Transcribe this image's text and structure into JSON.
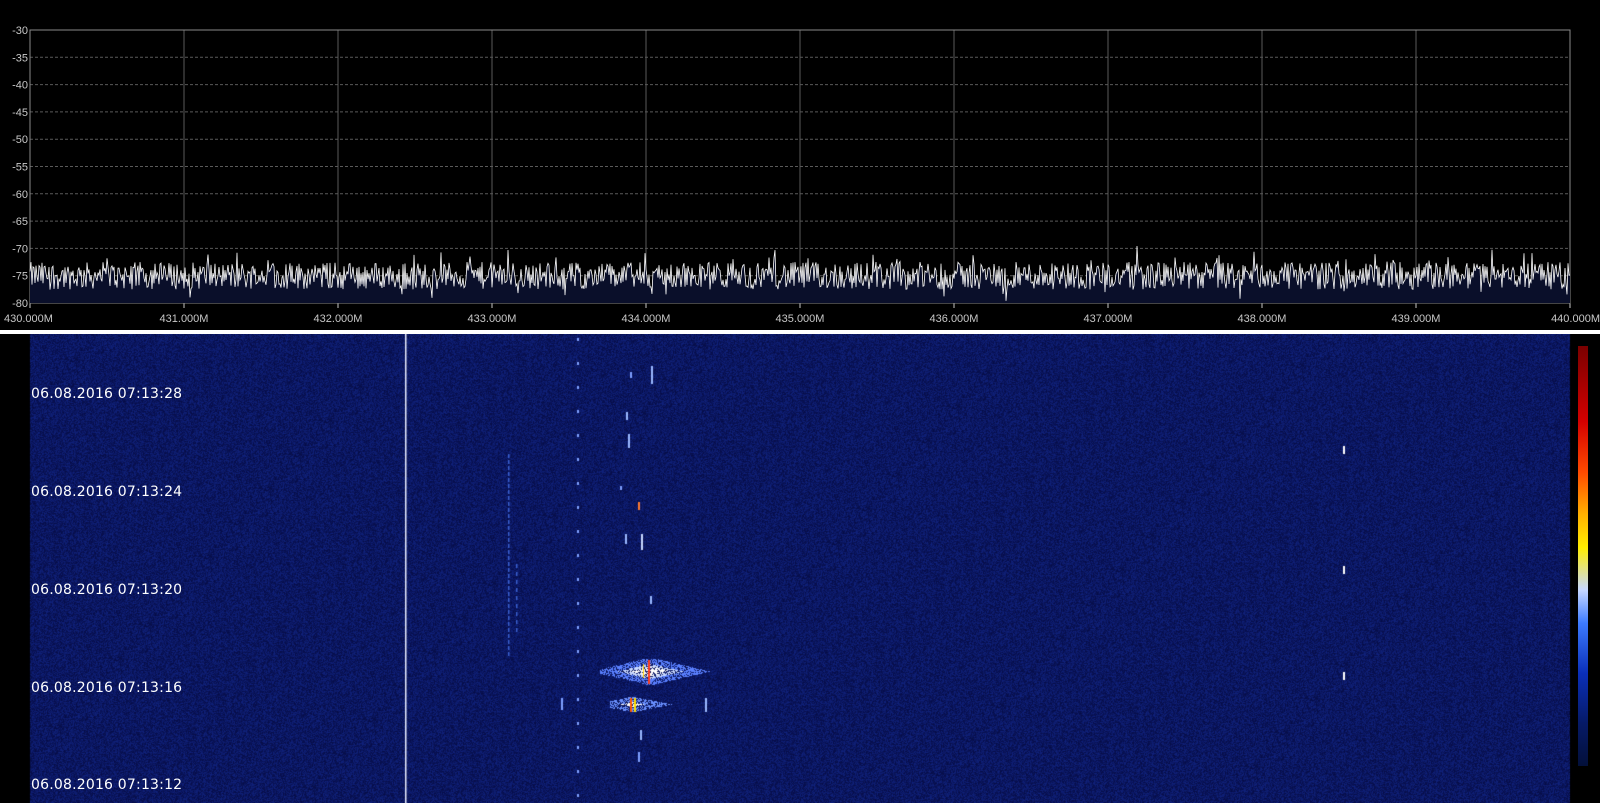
{
  "spectrum": {
    "y_ticks": [
      "-30",
      "-35",
      "-40",
      "-45",
      "-50",
      "-55",
      "-60",
      "-65",
      "-70",
      "-75",
      "-80"
    ],
    "x_ticks": [
      "430.000M",
      "431.000M",
      "432.000M",
      "433.000M",
      "434.000M",
      "435.000M",
      "436.000M",
      "437.000M",
      "438.000M",
      "439.000M",
      "440.000M"
    ],
    "y_range": [
      -80,
      -30
    ],
    "x_range_mhz": [
      430.0,
      440.0
    ],
    "noise_floor_db": -75,
    "trace_color": "#ffffff",
    "fill_color": "#0a0f2a",
    "grid_color": "#5a5a5a"
  },
  "waterfall": {
    "timestamps": [
      "06.08.2016 07:13:28",
      "06.08.2016 07:13:24",
      "06.08.2016 07:13:20",
      "06.08.2016 07:13:16",
      "06.08.2016 07:13:12"
    ],
    "background_color": "#0a1460"
  }
}
